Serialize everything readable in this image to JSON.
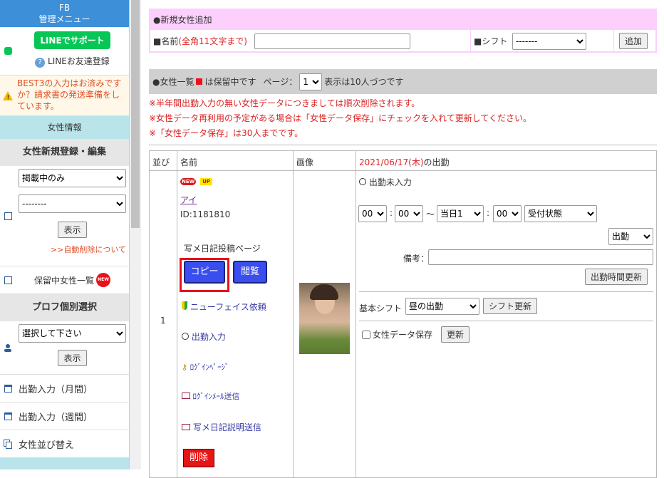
{
  "sidebar": {
    "header_line1": "FB",
    "header_line2": "管理メニュー",
    "line_badge": "LINEでサポート",
    "line_friend": "LINEお友達登録",
    "warn_text": "BEST3の入力はお済みですか？請求書の発送準備をしています。",
    "section_joseijoho": "女性情報",
    "section_shinki": "女性新規登録・編集",
    "filter_select": "掲載中のみ",
    "second_select": "--------",
    "show_button": "表示",
    "auto_delete_link": ">>自動削除について",
    "horyu_item": "保留中女性一覧",
    "new_badge": "NEW",
    "section_profile": "プロフ個別選択",
    "profile_select": "選択して下さい",
    "show_button2": "表示",
    "menu_monthly": "出勤入力（月間）",
    "menu_weekly": "出勤入力（週間）",
    "menu_sort": "女性並び替え"
  },
  "add_form": {
    "title": "●新規女性追加",
    "name_label": "■名前",
    "name_hint": "(全角11文字まで)",
    "name_value": "",
    "shift_label": "■シフト",
    "shift_value": "-------",
    "add_button": "追加"
  },
  "list_header": {
    "text1": "●女性一覧",
    "text2": "は保留中です",
    "page_label": "ページ：",
    "page_value": "1",
    "per_page": "表示は10人づつです"
  },
  "notices": [
    "※半年間出勤入力の無い女性データにつきましては順次削除されます。",
    "※女性データ再利用の予定がある場合は「女性データ保存」にチェックを入れて更新してください。",
    "※「女性データ保存」は30人までです。"
  ],
  "table": {
    "col_order": "並び",
    "col_name": "名前",
    "col_image": "画像",
    "col_date": "2021/06/17(木)",
    "col_date_suffix": "の出勤"
  },
  "row": {
    "order": "1",
    "new_tag": "NEW",
    "up_tag": "UP",
    "name": "アイ",
    "id": "ID:1181810",
    "diary_label": "写メ日記投稿ページ",
    "copy_button": "コピー",
    "view_button": "閲覧",
    "newface_link": "ニューフェイス依頼",
    "attendance_link": "出勤入力",
    "login_page_link": "ﾛｸﾞｲﾝﾍﾟｰｼﾞ",
    "login_mail_link": "ﾛｸﾞｲﾝﾒｰﾙ送信",
    "diary_mail_link": "写メ日記説明送信",
    "delete_button": "削除",
    "status_text": "出勤未入力",
    "hour_start": "00",
    "min_start": "00",
    "tilde": "〜",
    "day_end": "当日1",
    "min_end": "00",
    "reception": "受付状態",
    "work_select": "出勤",
    "note_label": "備考：",
    "note_value": "",
    "update_time_button": "出勤時間更新",
    "basic_shift_label": "基本シフト",
    "basic_shift_value": "昼の出勤",
    "shift_update_button": "シフト更新",
    "save_label": "女性データ保存",
    "update_button": "更新"
  },
  "colors": {
    "accent_blue": "#3d8fd8",
    "pink_bg": "#fccffc",
    "red": "#dd2222",
    "highlight": "#e8121b"
  }
}
